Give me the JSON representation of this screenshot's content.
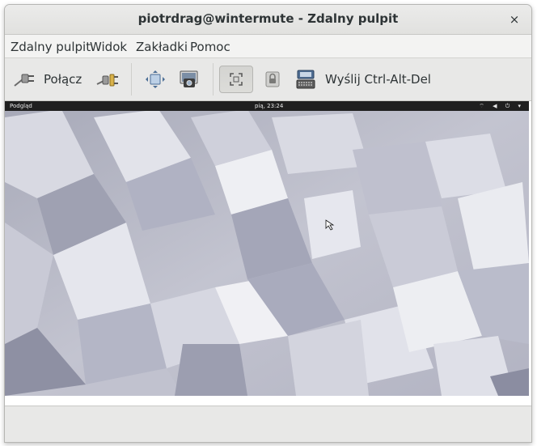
{
  "window": {
    "title": "piotrdrag@wintermute - Zdalny pulpit",
    "close_glyph": "×"
  },
  "menu": {
    "items": [
      {
        "label": "Zdalny pulpit"
      },
      {
        "label": "Widok"
      },
      {
        "label": "Zakładki"
      },
      {
        "label": "Pomoc"
      }
    ]
  },
  "toolbar": {
    "connect_label": "Połącz",
    "connect_icon": "plug-icon",
    "disconnect_icon": "unplug-icon",
    "fit_icon": "fit-window-icon",
    "screenshot_icon": "screenshot-icon",
    "fullscreen_icon": "fullscreen-icon",
    "keyboard_grab_icon": "lock-icon",
    "send_keys_icon": "keyboard-icon",
    "send_keys_label": "Wyślij Ctrl-Alt-Del"
  },
  "remote": {
    "topbar_left": "Podgląd",
    "topbar_center": "pią, 23:24",
    "topbar_icons": "⌔ ◀ ⏻ ▾"
  },
  "colors": {
    "window_bg": "#e8e8e7",
    "accent_desktop": "#b9bac6"
  }
}
